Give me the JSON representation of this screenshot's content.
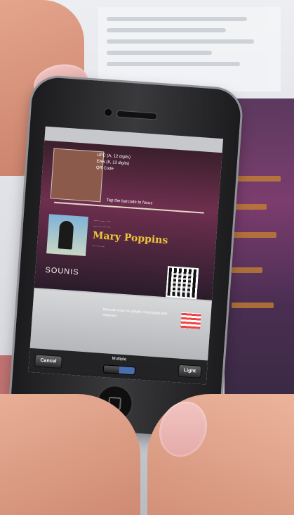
{
  "scene": {
    "description_icon": "hand-holding-phone",
    "accent": "#f0c53a"
  },
  "scanner_app": {
    "formats": {
      "upc": "UPC (A, 12 digits)",
      "ean": "EAN (8, 13 digits)",
      "qr": "QR Code"
    },
    "prompt": "Tap the barcode to focus",
    "album": {
      "line1": "— - — - —",
      "line2": "— — — —",
      "title": "Mary Poppins",
      "line3": "— — —"
    },
    "brand": "SOUNIS",
    "hint": "Barcode must be upright. Avoid glare and shadows.",
    "toolbar": {
      "cancel": "Cancel",
      "multiple": "Multiple",
      "light": "Light"
    }
  }
}
